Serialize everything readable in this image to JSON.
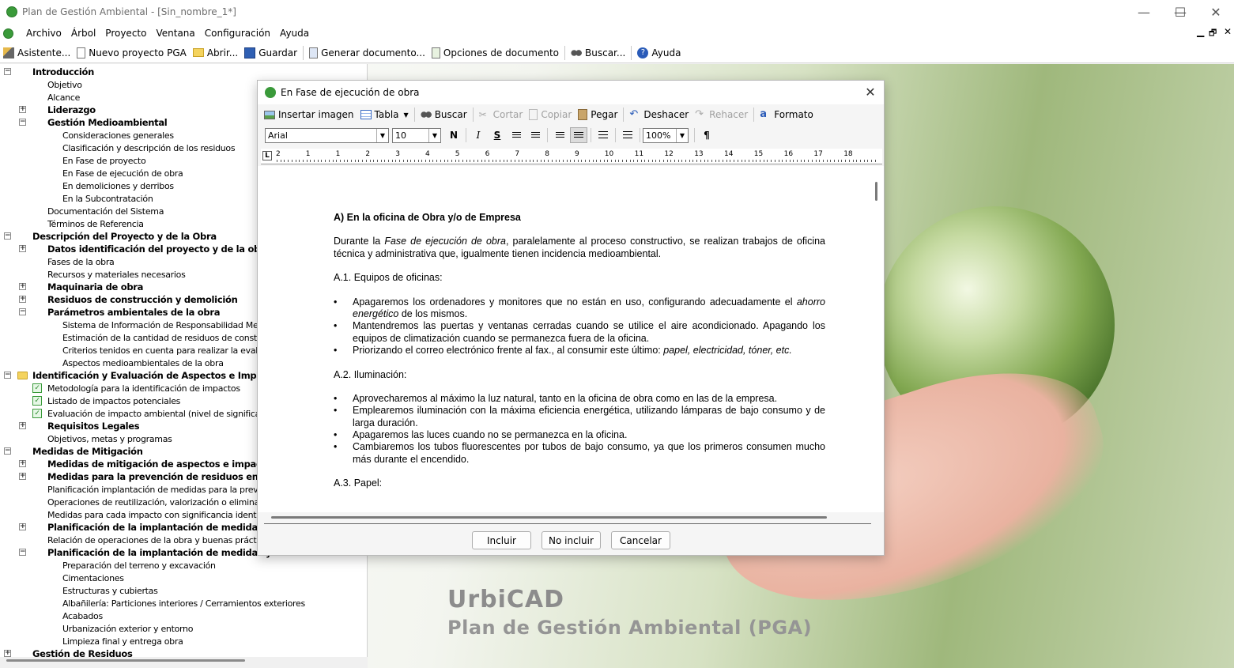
{
  "window": {
    "title": "Plan de Gestión Ambiental - [Sin_nombre_1*]",
    "minimize": "—",
    "maximize": "☐",
    "close": "✕"
  },
  "menu": [
    "Archivo",
    "Árbol",
    "Proyecto",
    "Ventana",
    "Configuración",
    "Ayuda"
  ],
  "mdi_controls": {
    "minimize": "▁",
    "restore": "🗗",
    "close": "✕"
  },
  "toolbar": [
    "Asistente...",
    "Nuevo proyecto PGA",
    "Abrir...",
    "Guardar",
    "Generar documento...",
    "Opciones de documento",
    "Buscar...",
    "Ayuda"
  ],
  "tree": [
    {
      "label": "Introducción",
      "level": 0,
      "bold": true,
      "exp": "minus"
    },
    {
      "label": "Objetivo",
      "level": 1,
      "bold": false
    },
    {
      "label": "Alcance",
      "level": 1,
      "bold": false
    },
    {
      "label": "Liderazgo",
      "level": 1,
      "bold": true,
      "exp": "plus"
    },
    {
      "label": "Gestión Medioambiental",
      "level": 1,
      "bold": true,
      "exp": "minus"
    },
    {
      "label": "Consideraciones generales",
      "level": 2,
      "bold": false
    },
    {
      "label": "Clasificación y descripción de los residuos",
      "level": 2,
      "bold": false
    },
    {
      "label": "En Fase de proyecto",
      "level": 2,
      "bold": false
    },
    {
      "label": "En Fase de ejecución de obra",
      "level": 2,
      "bold": false
    },
    {
      "label": "En demoliciones y derribos",
      "level": 2,
      "bold": false
    },
    {
      "label": "En la Subcontratación",
      "level": 2,
      "bold": false
    },
    {
      "label": "Documentación del Sistema",
      "level": 1,
      "bold": false
    },
    {
      "label": "Términos de Referencia",
      "level": 1,
      "bold": false
    },
    {
      "label": "Descripción del Proyecto y de la Obra",
      "level": 0,
      "bold": true,
      "exp": "minus"
    },
    {
      "label": "Datos identificación del proyecto y de la obra",
      "level": 1,
      "bold": true,
      "exp": "plus"
    },
    {
      "label": "Fases de la obra",
      "level": 1,
      "bold": false
    },
    {
      "label": "Recursos y materiales necesarios",
      "level": 1,
      "bold": false
    },
    {
      "label": "Maquinaria de obra",
      "level": 1,
      "bold": true,
      "exp": "plus"
    },
    {
      "label": "Residuos de construcción y demolición",
      "level": 1,
      "bold": true,
      "exp": "plus"
    },
    {
      "label": "Parámetros ambientales de la obra",
      "level": 1,
      "bold": true,
      "exp": "minus"
    },
    {
      "label": "Sistema de Información de Responsabilidad Medioambiental",
      "level": 2,
      "bold": false
    },
    {
      "label": "Estimación de la cantidad de residuos de construcción",
      "level": 2,
      "bold": false
    },
    {
      "label": "Criterios tenidos en cuenta para realizar la evaluación",
      "level": 2,
      "bold": false
    },
    {
      "label": "Aspectos medioambientales de la obra",
      "level": 2,
      "bold": false
    },
    {
      "label": "Identificación y Evaluación de Aspectos e Impactos",
      "level": 0,
      "bold": true,
      "exp": "minus",
      "folder": true
    },
    {
      "label": "Metodología para la identificación de impactos",
      "level": 1,
      "bold": false,
      "check": true
    },
    {
      "label": "Listado de impactos potenciales",
      "level": 1,
      "bold": false,
      "check": true
    },
    {
      "label": "Evaluación de impacto ambiental (nivel de significancia)",
      "level": 1,
      "bold": false,
      "check": true
    },
    {
      "label": "Requisitos Legales",
      "level": 1,
      "bold": true,
      "exp": "plus"
    },
    {
      "label": "Objetivos, metas y programas",
      "level": 1,
      "bold": false
    },
    {
      "label": "Medidas de Mitigación",
      "level": 0,
      "bold": true,
      "exp": "minus"
    },
    {
      "label": "Medidas de mitigación de aspectos e impactos",
      "level": 1,
      "bold": true,
      "exp": "plus"
    },
    {
      "label": "Medidas para la prevención de residuos en la obra",
      "level": 1,
      "bold": true,
      "exp": "plus"
    },
    {
      "label": "Planificación implantación de medidas para la prevención",
      "level": 1,
      "bold": false
    },
    {
      "label": "Operaciones de reutilización, valorización o eliminación a",
      "level": 1,
      "bold": false
    },
    {
      "label": "Medidas para cada impacto con significancia identificada",
      "level": 1,
      "bold": false
    },
    {
      "label": "Planificación de la implantación de medidas para",
      "level": 1,
      "bold": true,
      "exp": "plus"
    },
    {
      "label": "Relación de operaciones de la obra y buenas prácticas medioambientales",
      "level": 1,
      "bold": false
    },
    {
      "label": "Planificación de la implantación de medidas y buenas",
      "level": 1,
      "bold": true,
      "exp": "minus"
    },
    {
      "label": "Preparación del terreno y excavación",
      "level": 2,
      "bold": false
    },
    {
      "label": "Cimentaciones",
      "level": 2,
      "bold": false
    },
    {
      "label": "Estructuras y cubiertas",
      "level": 2,
      "bold": false
    },
    {
      "label": "Albañilería: Particiones interiores / Cerramientos exteriores",
      "level": 2,
      "bold": false
    },
    {
      "label": "Acabados",
      "level": 2,
      "bold": false
    },
    {
      "label": "Urbanización exterior y entorno",
      "level": 2,
      "bold": false
    },
    {
      "label": "Limpieza final y entrega obra",
      "level": 2,
      "bold": false
    },
    {
      "label": "Gestión de Residuos",
      "level": 0,
      "bold": true,
      "exp": "plus"
    }
  ],
  "brand": {
    "line1": "UrbiCAD",
    "line2": "Plan de Gestión Ambiental (PGA)"
  },
  "dialog": {
    "title": "En Fase de ejecución de obra",
    "close": "✕",
    "toolbar": [
      {
        "label": "Insertar imagen",
        "enabled": true
      },
      {
        "label": "Tabla",
        "enabled": true
      },
      {
        "label": "Buscar",
        "enabled": true
      },
      {
        "label": "Cortar",
        "enabled": false
      },
      {
        "label": "Copiar",
        "enabled": false
      },
      {
        "label": "Pegar",
        "enabled": true
      },
      {
        "label": "Deshacer",
        "enabled": true
      },
      {
        "label": "Rehacer",
        "enabled": false
      },
      {
        "label": "Formato",
        "enabled": true
      }
    ],
    "font": "Arial",
    "size": "10",
    "zoom": "100%",
    "format_buttons": {
      "bold": "N",
      "italic": "I",
      "underline": "S",
      "para": "¶"
    },
    "ruler": {
      "tab": "L",
      "marks": [
        "2",
        "1",
        "1",
        "2",
        "3",
        "4",
        "5",
        "6",
        "7",
        "8",
        "9",
        "10",
        "11",
        "12",
        "13",
        "14",
        "15",
        "16",
        "17",
        "18"
      ]
    },
    "document": {
      "heading": "A) En la oficina de Obra y/o de Empresa",
      "intro_pre": "Durante la ",
      "intro_em": "Fase de ejecución de obra",
      "intro_post": ", paralelamente al proceso constructivo, se realizan trabajos de oficina técnica y administrativa que, igualmente tienen incidencia medioambiental.",
      "s1": "A.1. Equipos de oficinas:",
      "s1_b1_pre": "Apagaremos los ordenadores y monitores que no están en uso, configurando adecuadamente el ",
      "s1_b1_em": "ahorro energético",
      "s1_b1_post": " de los mismos.",
      "s1_b2": "Mantendremos las puertas y ventanas cerradas cuando se utilice el aire acondicionado. Apagando los equipos de climatización cuando se permanezca fuera de la oficina.",
      "s1_b3_pre": "Priorizando el correo electrónico frente al fax., al consumir este último: ",
      "s1_b3_em": "papel, electricidad, tóner, etc.",
      "s2": "A.2. Iluminación:",
      "s2_b1": "Aprovecharemos al máximo la luz natural, tanto en la oficina de obra como en las de la empresa.",
      "s2_b2": "Emplearemos iluminación con la máxima eficiencia energética, utilizando lámparas de bajo consumo y de larga duración.",
      "s2_b3": "Apagaremos las luces cuando no se permanezca en la oficina.",
      "s2_b4": "Cambiaremos los tubos fluorescentes por tubos de bajo consumo, ya que los primeros consumen mucho más durante el encendido.",
      "s3": "A.3. Papel:"
    },
    "buttons": {
      "include": "Incluir",
      "exclude": "No incluir",
      "cancel": "Cancelar"
    }
  }
}
